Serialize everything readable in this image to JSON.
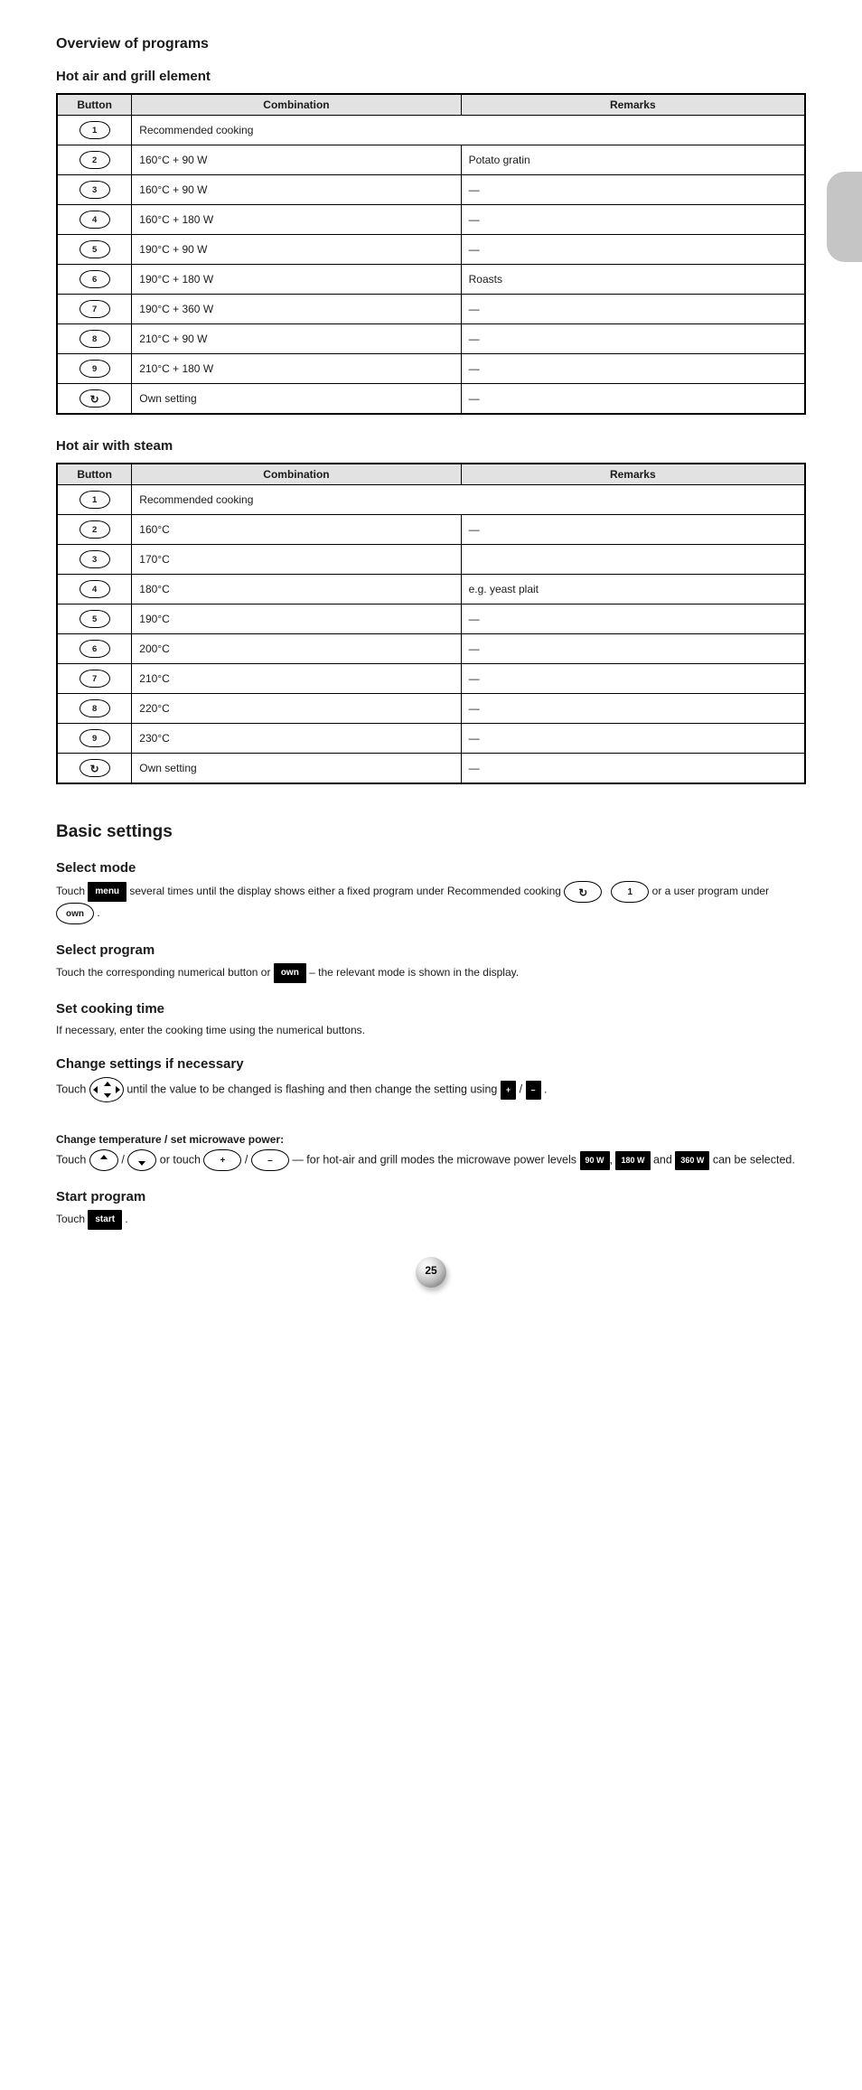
{
  "page_title": "Overview of programs",
  "page_number": "25",
  "table_headers": {
    "button": "Button",
    "combi": "Combination",
    "notes": "Remarks"
  },
  "table1": {
    "title": "Hot air and grill element",
    "rows": [
      {
        "btn": "1",
        "combi_span": "Recommended cooking",
        "notes": ""
      },
      {
        "btn": "2",
        "combi": "160°C + 90 W",
        "notes": "Potato gratin"
      },
      {
        "btn": "3",
        "combi": "160°C + 90 W",
        "notes": "—"
      },
      {
        "btn": "4",
        "combi": "160°C + 180 W",
        "notes": "—"
      },
      {
        "btn": "5",
        "combi": "190°C + 90 W",
        "notes": "—"
      },
      {
        "btn": "6",
        "combi": "190°C + 180 W",
        "notes": "Roasts"
      },
      {
        "btn": "7",
        "combi": "190°C + 360 W",
        "notes": "—"
      },
      {
        "btn": "8",
        "combi": "210°C + 90 W",
        "notes": "—"
      },
      {
        "btn": "9",
        "combi": "210°C + 180 W",
        "notes": "—"
      },
      {
        "btn": "mem",
        "combi": "Own setting",
        "notes": "—",
        "icon": "↻"
      }
    ]
  },
  "table2": {
    "title": "Hot air with steam",
    "rows": [
      {
        "btn": "1",
        "combi_span": "Recommended cooking",
        "notes": ""
      },
      {
        "btn": "2",
        "combi": "160°C",
        "notes": "—"
      },
      {
        "btn": "3",
        "combi": "170°C",
        "notes": ""
      },
      {
        "btn": "4",
        "combi": "180°C",
        "notes": "e.g. yeast plait"
      },
      {
        "btn": "5",
        "combi": "190°C",
        "notes": "—"
      },
      {
        "btn": "6",
        "combi": "200°C",
        "notes": "—"
      },
      {
        "btn": "7",
        "combi": "210°C",
        "notes": "—"
      },
      {
        "btn": "8",
        "combi": "220°C",
        "notes": "—"
      },
      {
        "btn": "9",
        "combi": "230°C",
        "notes": "—"
      },
      {
        "btn": "mem",
        "combi": "Own setting",
        "notes": "—",
        "icon": "↻"
      }
    ]
  },
  "section_title": "Basic settings",
  "step1": {
    "title": "Select mode",
    "text_before": "Touch ",
    "badge": "menu",
    "text_after": " several times until the display shows either a fixed program under Recommended cooking ",
    "mem_icon": "↻",
    "badge1": "1",
    "text_mid": " or a user program under ",
    "badge_own": "own",
    "period": "."
  },
  "step2": {
    "title": "Select program",
    "text_before": "Touch the corresponding numerical button or ",
    "badge": "own",
    "text_after": " – the relevant mode is shown in the display."
  },
  "step3": {
    "title": "Set cooking time",
    "text": "If necessary, enter the cooking time using the numerical buttons."
  },
  "step4": {
    "title": "Change settings if necessary",
    "text_before": "Touch ",
    "text_after": " until the value to be changed is flashing and then change the setting using ",
    "plus": "+",
    "minus": "–",
    "period": "."
  },
  "temp_block": {
    "title": "Change temperature / set microwave power:",
    "up_label": "up",
    "down_label": "down",
    "text_before": "Touch ",
    "or": "/",
    "text_mid": " or touch ",
    "plus": "+",
    "minus": "–",
    "text_after": " — for hot-air and grill modes the microwave power levels ",
    "pw1": "90 W",
    "pw2": "180 W",
    "pw3": "360 W",
    "and": " and ",
    "can": " can be selected."
  },
  "start_block": {
    "title": "Start program",
    "text_before": "Touch ",
    "badge": "start",
    "text_after": "."
  }
}
